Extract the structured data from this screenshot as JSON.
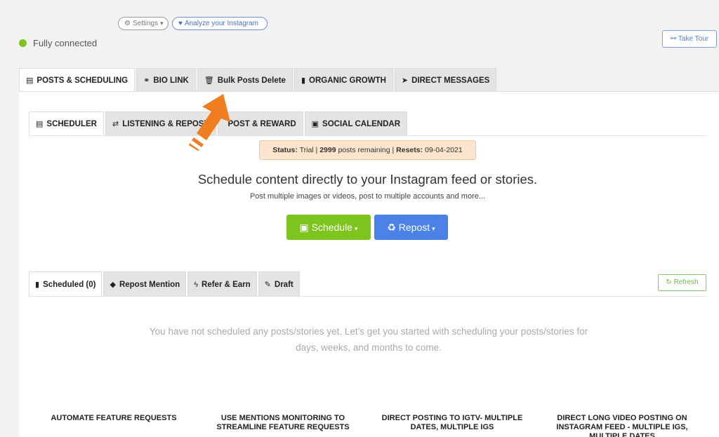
{
  "top": {
    "settings_label": "Settings",
    "analyze_label": "Analyze your Instagram",
    "connection_status": "Fully connected",
    "take_tour_label": "Take Tour"
  },
  "main_tabs": [
    {
      "label": "POSTS & SCHEDULING",
      "icon": "calendar-icon",
      "glyph": "▤"
    },
    {
      "label": "BIO LINK",
      "icon": "link-icon",
      "glyph": "⚭"
    },
    {
      "label": "Bulk Posts Delete",
      "icon": "trash-icon",
      "glyph": "🗑"
    },
    {
      "label": "ORGANIC GROWTH",
      "icon": "bar-chart-icon",
      "glyph": "▮"
    },
    {
      "label": "DIRECT MESSAGES",
      "icon": "send-icon",
      "glyph": "➤"
    }
  ],
  "sub_tabs": [
    {
      "label": "SCHEDULER",
      "icon": "calendar-icon",
      "glyph": "▤"
    },
    {
      "label": "LISTENING & REPOST",
      "icon": "repost-icon",
      "glyph": "⇄"
    },
    {
      "label": "POST & REWARD",
      "icon": "gift-icon",
      "glyph": ""
    },
    {
      "label": "SOCIAL CALENDAR",
      "icon": "calendar-icon",
      "glyph": "▣"
    }
  ],
  "plan_status": {
    "status_label": "Status:",
    "status_value": "Trial",
    "remaining_count": "2999",
    "remaining_text": "posts remaining",
    "resets_label": "Resets:",
    "resets_value": "09-04-2021"
  },
  "headline": "Schedule content directly to your Instagram feed or stories.",
  "subheadline": "Post multiple images or videos, post to multiple accounts and more...",
  "buttons": {
    "schedule_label": "Schedule",
    "repost_label": "Repost"
  },
  "lower_tabs": [
    {
      "label": "Scheduled (0)",
      "icon": "bar-chart-icon",
      "glyph": "▮"
    },
    {
      "label": "Repost Mention",
      "icon": "tag-icon",
      "glyph": "◆"
    },
    {
      "label": "Refer & Earn",
      "icon": "bolt-icon",
      "glyph": "ϟ"
    },
    {
      "label": "Draft",
      "icon": "edit-icon",
      "glyph": "✎"
    }
  ],
  "refresh_label": "Refresh",
  "empty_message": "You have not scheduled any posts/stories yet. Let's get you started with scheduling your posts/stories for days, weeks, and months to come.",
  "features": [
    "AUTOMATE FEATURE REQUESTS",
    "USE MENTIONS MONITORING TO STREAMLINE FEATURE REQUESTS",
    "DIRECT POSTING TO IGTV- MULTIPLE DATES, MULTIPLE IGS",
    "DIRECT LONG VIDEO POSTING ON INSTAGRAM FEED - MULTIPLE IGS, MULTIPLE DATES"
  ],
  "colors": {
    "accent_green": "#7dc41e",
    "accent_blue": "#4b82e8",
    "status_bg": "#fbe5cc",
    "arrow_orange": "#f07d20"
  }
}
